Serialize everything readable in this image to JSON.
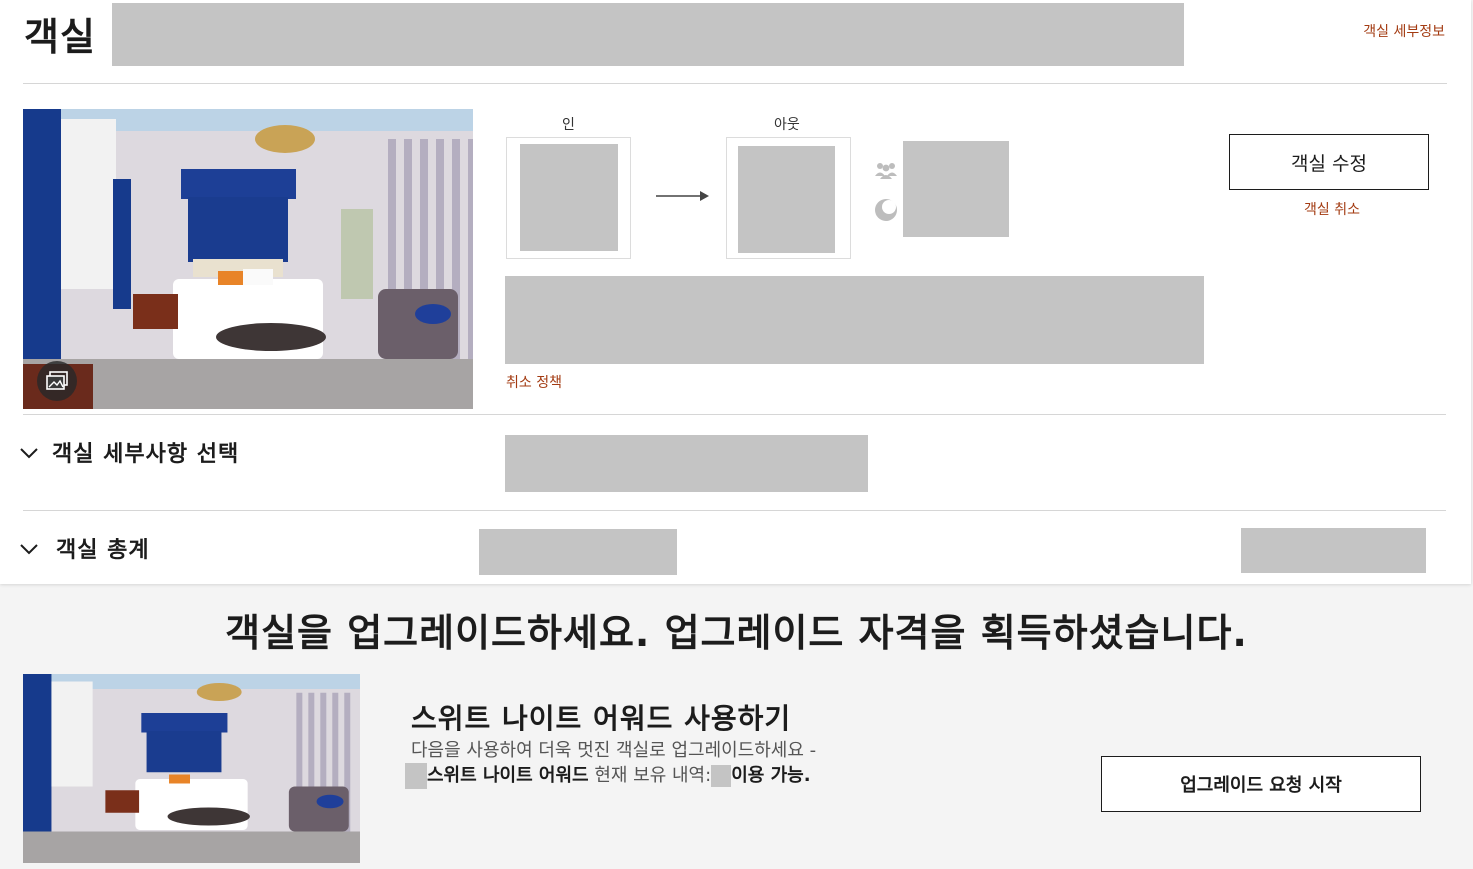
{
  "header": {
    "title": "객실",
    "details_link": "객실 세부정보"
  },
  "stay": {
    "checkin_label": "인",
    "checkout_label": "아웃",
    "cancel_policy_link": "취소 정책"
  },
  "actions": {
    "modify_button": "객실 수정",
    "cancel_room_link": "객실 취소"
  },
  "sections": {
    "room_details_select": "객실 세부사항 선택",
    "room_total": "객실 총계"
  },
  "upgrade": {
    "heading": "객실을 업그레이드하세요. 업그레이드 자격을 획득하셨습니다.",
    "award_title": "스위트 나이트 어워드 사용하기",
    "desc_line1": "다음을 사용하여 더욱 멋진 객실로 업그레이드하세요 -",
    "desc_award_name": "스위트 나이트 어워드",
    "desc_holding": "현재 보유 내역:",
    "desc_available": "이용 가능.",
    "request_button": "업그레이드 요청 시작"
  },
  "icons": {
    "gallery": "gallery-icon",
    "guests": "guests-icon",
    "night": "moon-icon",
    "arrow": "arrow-right-icon",
    "chevron": "chevron-down-icon"
  },
  "colors": {
    "accent_link": "#a33b12",
    "redacted": "#c4c4c4",
    "text": "#1c1c1c"
  }
}
